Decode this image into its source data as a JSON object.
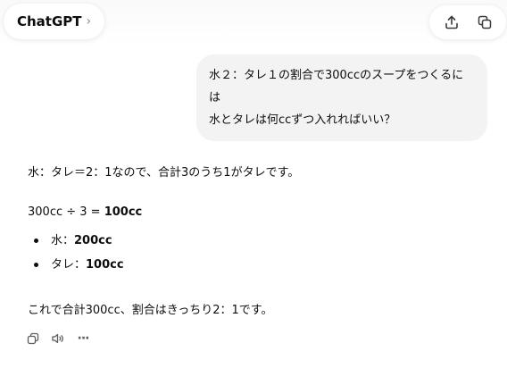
{
  "header": {
    "model_name": "ChatGPT",
    "chevron": "›",
    "icons": [
      "chevron-right-icon",
      "share-icon",
      "new-chat-icon"
    ]
  },
  "conversation": {
    "user_message": {
      "line1": "水２：タレ１の割合で300ccのスープをつくるには",
      "line2": "水とタレは何ccずつ入れればいい？"
    },
    "assistant": {
      "intro": "水：タレ＝2：1なので、合計3のうち1がタレです。",
      "calc_prefix": "300cc ÷ 3 = ",
      "calc_result": "100cc",
      "items": [
        {
          "label": "水：",
          "value": "200cc"
        },
        {
          "label": "タレ：",
          "value": "100cc"
        }
      ],
      "conclusion": "これで合計300cc、割合はきっちり2：1です。"
    },
    "actions": {
      "icons": [
        "copy-icon",
        "read-aloud-icon",
        "more-icon"
      ],
      "more_label": "···"
    }
  }
}
